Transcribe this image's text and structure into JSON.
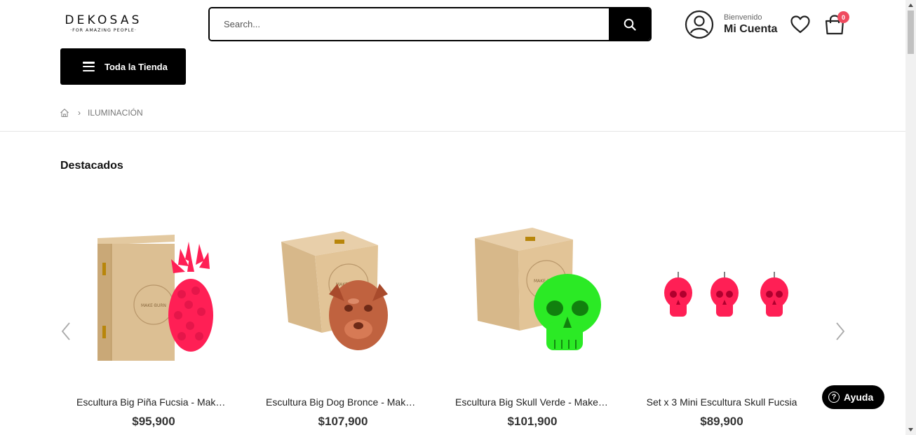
{
  "header": {
    "logo_main": "DEKOSAS",
    "logo_sub": "·FOR AMAZING PEOPLE·",
    "search_placeholder": "Search...",
    "account_greeting": "Bienvenido",
    "account_name": "Mi Cuenta",
    "cart_count": "0",
    "icons": [
      "search-icon",
      "user-icon",
      "heart-icon",
      "shopping-bag-icon"
    ]
  },
  "nav": {
    "categories_label": "Toda la Tienda"
  },
  "breadcrumb": {
    "current": "ILUMINACIÓN"
  },
  "section": {
    "title": "Destacados"
  },
  "products": [
    {
      "name": "Escultura Big Piña Fucsia - Make Burn",
      "price": "$95,900"
    },
    {
      "name": "Escultura Big Dog Bronce - Make Burn",
      "price": "$107,900"
    },
    {
      "name": "Escultura Big Skull Verde - Make Burn",
      "price": "$101,900"
    },
    {
      "name": "Set x 3 Mini Escultura Skull Fucsia",
      "price": "$89,900"
    }
  ],
  "help": {
    "label": "Ayuda"
  },
  "colors": {
    "accent": "#000000",
    "badge": "#ef4b5f",
    "fuchsia": "#ff1f55",
    "neon_green": "#2bea25",
    "bronze": "#c0623f"
  }
}
